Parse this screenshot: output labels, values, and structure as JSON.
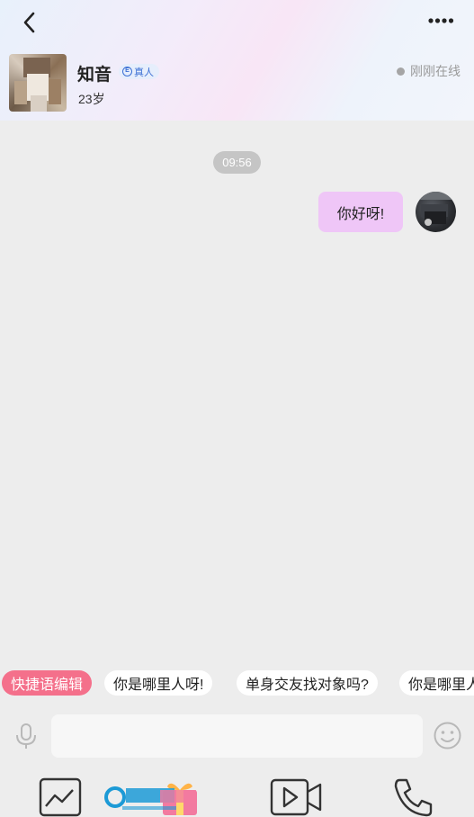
{
  "header": {
    "peer_name": "知音",
    "badge_label": "真人",
    "badge_mark": "E",
    "age": "23岁",
    "status": "刚刚在线"
  },
  "chat": {
    "timestamp": "09:56",
    "messages": [
      {
        "from": "self",
        "text": "你好呀!"
      }
    ]
  },
  "quick_phrases": {
    "edit_label": "快捷语编辑",
    "items": [
      "你是哪里人呀!",
      "单身交友找对象吗?",
      "你是哪里人"
    ]
  },
  "input": {
    "placeholder": ""
  },
  "icons": {
    "back": "chevron-left-icon",
    "more": "more-dots-icon",
    "mic": "microphone-icon",
    "emoji": "emoji-smile-icon",
    "image": "image-icon",
    "gift": "gift-icon",
    "video": "video-camera-icon",
    "phone": "phone-icon"
  },
  "colors": {
    "bubble_self": "#efc6f7",
    "quick_edit_bg": "#f4708b",
    "badge_text": "#3b6fd4"
  }
}
